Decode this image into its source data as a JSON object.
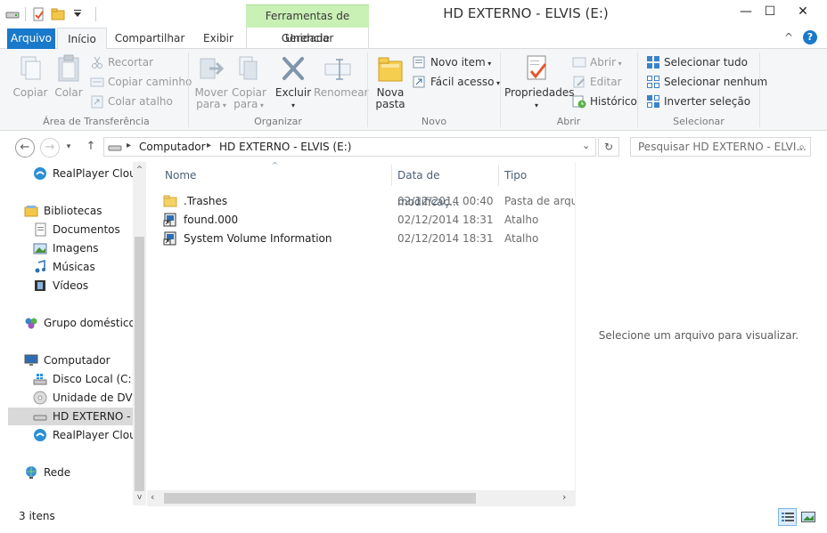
{
  "window": {
    "title": "HD EXTERNO - ELVIS (E:)",
    "context_group": "Ferramentas de Unidade",
    "minimize_glyph": "—",
    "maximize_glyph": "☐",
    "close_glyph": "✕"
  },
  "tabs": {
    "arquivo": "Arquivo",
    "inicio": "Início",
    "compartilhar": "Compartilhar",
    "exibir": "Exibir",
    "gerenciar": "Gerenciar"
  },
  "ribbon": {
    "clipboard": {
      "label": "Área de Transferência",
      "copiar": "Copiar",
      "colar": "Colar",
      "recortar": "Recortar",
      "copiar_caminho": "Copiar caminho",
      "colar_atalho": "Colar atalho"
    },
    "organize": {
      "label": "Organizar",
      "mover_l1": "Mover",
      "mover_l2": "para",
      "copiar_l1": "Copiar",
      "copiar_l2": "para",
      "excluir": "Excluir",
      "renomear": "Renomear"
    },
    "new": {
      "label": "Novo",
      "nova_l1": "Nova",
      "nova_l2": "pasta",
      "novo_item": "Novo item",
      "facil_acesso": "Fácil acesso"
    },
    "open": {
      "label": "Abrir",
      "propriedades": "Propriedades",
      "abrir": "Abrir",
      "editar": "Editar",
      "historico": "Histórico"
    },
    "select": {
      "label": "Selecionar",
      "tudo": "Selecionar tudo",
      "nenhum": "Selecionar nenhum",
      "inverter": "Inverter seleção"
    }
  },
  "address": {
    "crumb1": "Computador",
    "crumb2": "HD EXTERNO - ELVIS (E:)",
    "search_placeholder": "Pesquisar HD EXTERNO - ELVI..."
  },
  "nav": {
    "items": [
      {
        "label": "RealPlayer Cloud"
      },
      {
        "label": "Bibliotecas"
      },
      {
        "label": "Documentos"
      },
      {
        "label": "Imagens"
      },
      {
        "label": "Músicas"
      },
      {
        "label": "Vídeos"
      },
      {
        "label": "Grupo doméstico"
      },
      {
        "label": "Computador"
      },
      {
        "label": "Disco Local (C:)"
      },
      {
        "label": "Unidade de DVD-"
      },
      {
        "label": "HD EXTERNO - E"
      },
      {
        "label": "RealPlayer Cloud"
      },
      {
        "label": "Rede"
      }
    ]
  },
  "columns": {
    "name": "Nome",
    "date": "Data de modificaç...",
    "type": "Tipo"
  },
  "files": [
    {
      "name": ".Trashes",
      "date": "02/12/2014 00:40",
      "type": "Pasta de arquivos"
    },
    {
      "name": "found.000",
      "date": "02/12/2014 18:31",
      "type": "Atalho"
    },
    {
      "name": "System Volume Information",
      "date": "02/12/2014 18:31",
      "type": "Atalho"
    }
  ],
  "preview": {
    "text": "Selecione um arquivo para visualizar."
  },
  "status": {
    "count": "3 itens"
  },
  "colors": {
    "accent": "#1979ca",
    "context": "#c9f0b5",
    "ribbon_bg": "#f5f6f7"
  }
}
